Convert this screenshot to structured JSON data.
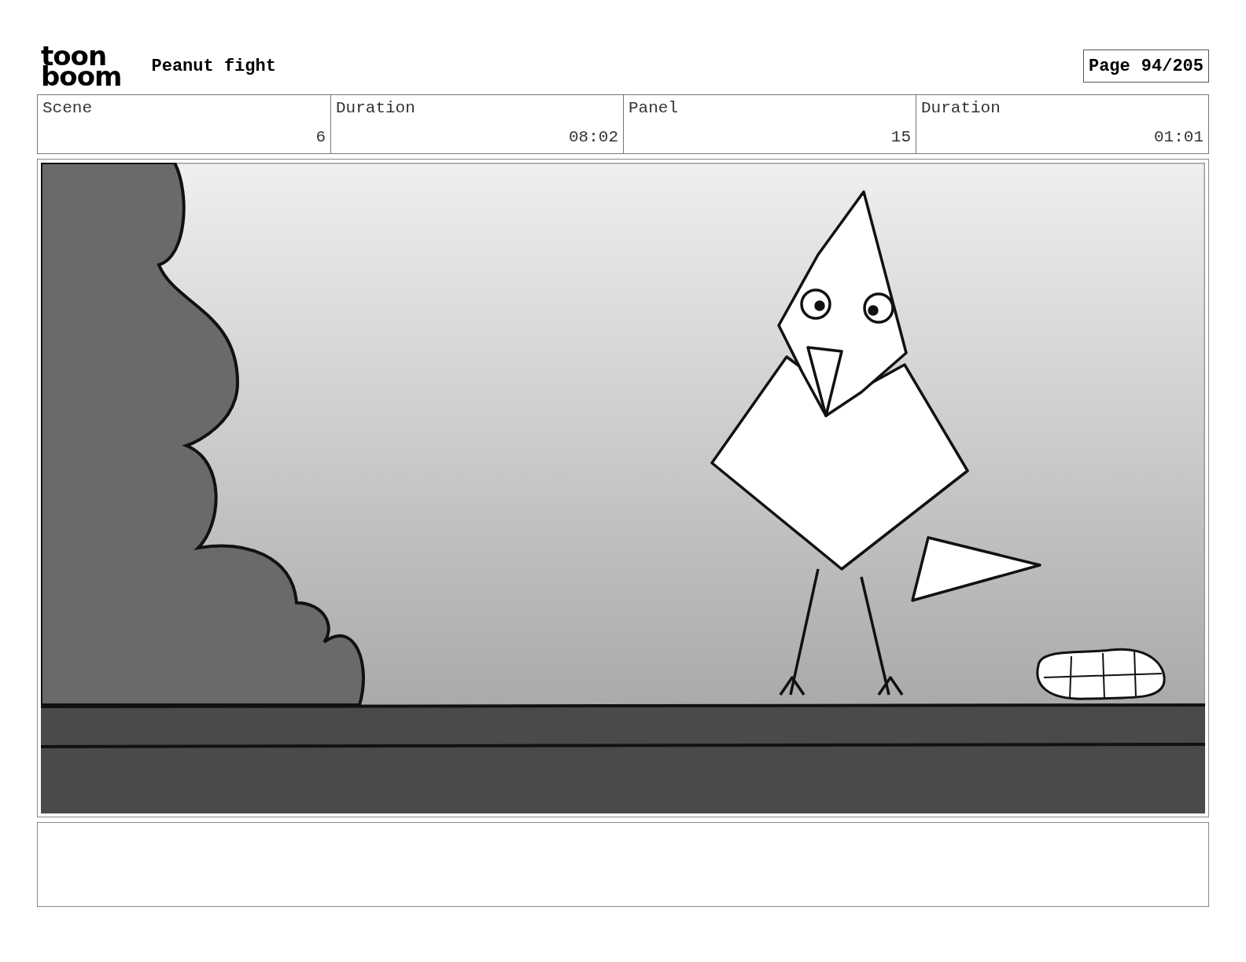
{
  "logo": {
    "lines": [
      "toon",
      "boom"
    ]
  },
  "title": "Peanut fight",
  "page": {
    "label": "Page",
    "value": "94/205"
  },
  "info": {
    "labels": [
      "Scene",
      "Duration",
      "Panel",
      "Duration"
    ],
    "values": [
      "6",
      "08:02",
      "15",
      "01:01"
    ]
  }
}
